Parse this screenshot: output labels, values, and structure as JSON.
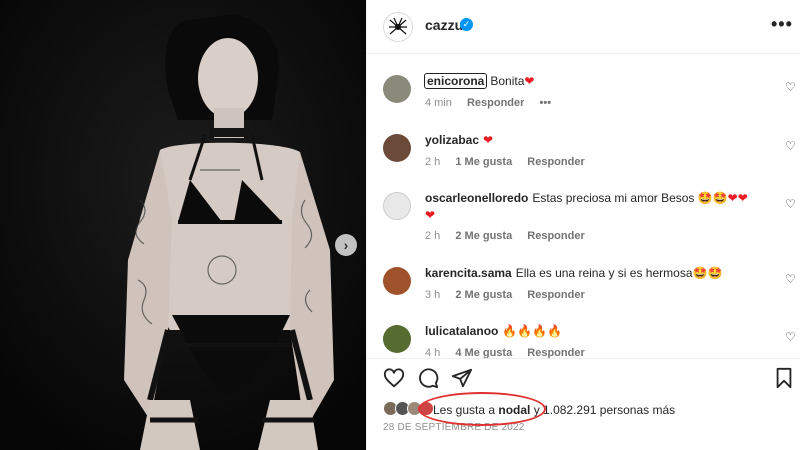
{
  "post": {
    "username": "cazzu",
    "verified_icon": "verified-badge-icon",
    "more_icon": "more-options-icon",
    "next_arrow": "›"
  },
  "comments": [
    {
      "user": "enicorona",
      "text": "Bonita",
      "emoji": "❤",
      "time": "4 min",
      "likes": "",
      "reply": "Responder",
      "more": "•••"
    },
    {
      "user": "yolizabac",
      "text": "",
      "emoji": "❤",
      "time": "2 h",
      "likes": "1 Me gusta",
      "reply": "Responder"
    },
    {
      "user": "oscarleonelloredo",
      "text": "Estas preciosa mi amor Besos",
      "emoji": "🤩🤩❤❤",
      "emoji2": "❤",
      "time": "2 h",
      "likes": "2 Me gusta",
      "reply": "Responder"
    },
    {
      "user": "karencita.sama",
      "text": "Ella es una reina y si es hermosa",
      "emoji": "🤩🤩",
      "time": "3 h",
      "likes": "2 Me gusta",
      "reply": "Responder"
    },
    {
      "user": "lulicatalanoo",
      "text": "",
      "emoji": "🔥🔥🔥🔥",
      "time": "4 h",
      "likes": "4 Me gusta",
      "reply": "Responder"
    }
  ],
  "likes": {
    "prefix": "Les gusta a ",
    "user": "nodal",
    "suffix": " y 1.082.291 personas más"
  },
  "date": "28 DE SEPTIEMBRE DE 2022",
  "colors": {
    "accent": "#0095f6",
    "heart": "#ed1c24",
    "annotation": "#e03131"
  }
}
